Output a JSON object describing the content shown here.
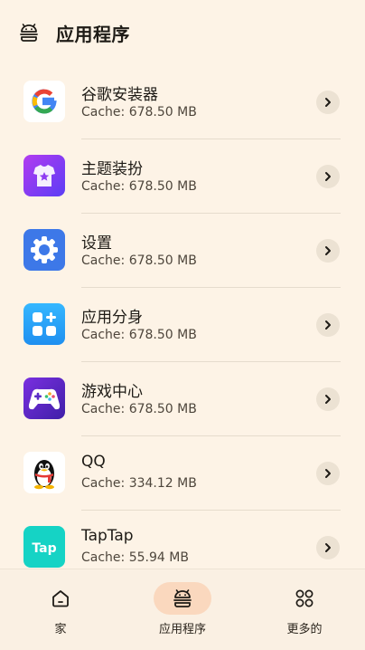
{
  "header": {
    "title": "应用程序",
    "icon": "android-robot-icon"
  },
  "apps": [
    {
      "name": "谷歌安装器",
      "cache": "Cache: 678.50 MB",
      "icon": "google-logo-icon"
    },
    {
      "name": "主题装扮",
      "cache": "Cache: 678.50 MB",
      "icon": "theme-shirt-icon"
    },
    {
      "name": "设置",
      "cache": "Cache: 678.50 MB",
      "icon": "settings-gear-icon"
    },
    {
      "name": "应用分身",
      "cache": "Cache: 678.50 MB",
      "icon": "app-clone-icon"
    },
    {
      "name": "游戏中心",
      "cache": "Cache: 678.50 MB",
      "icon": "gamepad-icon"
    },
    {
      "name": "QQ",
      "cache": "Cache: 334.12 MB",
      "icon": "qq-penguin-icon"
    },
    {
      "name": "TapTap",
      "cache": "Cache: 55.94 MB",
      "icon": "taptap-logo-icon"
    }
  ],
  "nav": [
    {
      "label": "家",
      "icon": "home-icon",
      "active": false
    },
    {
      "label": "应用程序",
      "icon": "android-robot-icon",
      "active": true
    },
    {
      "label": "更多的",
      "icon": "more-circles-icon",
      "active": false
    }
  ],
  "colors": {
    "background": "#FDF3E6",
    "active_pill": "#FAD8BE",
    "chevron_bg": "#ECE2D3",
    "divider": "#E6DCCD"
  }
}
